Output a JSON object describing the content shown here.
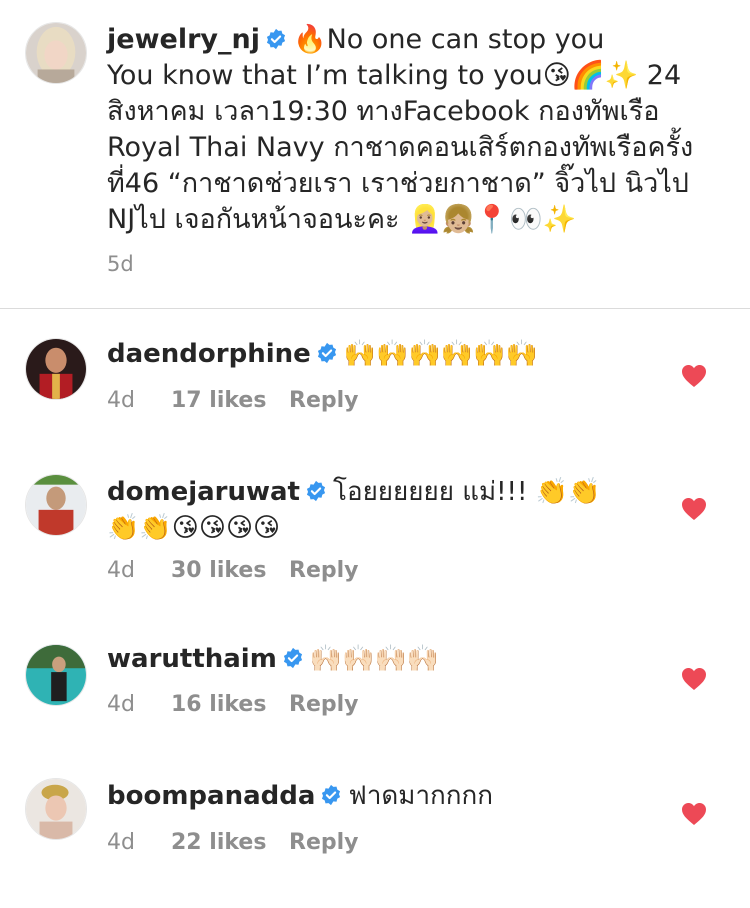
{
  "caption": {
    "username": "jewelry_nj",
    "line1": "🔥No one can stop you",
    "line2": "You know that I’m talking to you😘🌈✨ 24",
    "line3": "สิงหาคม เวลา19:30 ทางFacebook กองทัพเรือ",
    "line4": "Royal Thai Navy กาชาดคอนเสิร์ตกองทัพเรือครั้ง",
    "line5": "ที่46 “กาชาดช่วยเรา เราช่วยกาชาด” จิ๊วไป นิวไป",
    "line6": "NJไป เจอกันหน้าจอนะคะ 👱🏼‍♀️👧🏼📍👀✨",
    "time": "5d"
  },
  "comments": [
    {
      "username": "daendorphine",
      "line1": "🙌🙌🙌🙌🙌🙌",
      "line2": "",
      "time": "4d",
      "likes": "17 likes",
      "reply": "Reply"
    },
    {
      "username": "domejaruwat",
      "line1": "โอยยยยยย แม่!!! 👏👏",
      "line2": "👏👏😘😘😘😘",
      "time": "4d",
      "likes": "30 likes",
      "reply": "Reply"
    },
    {
      "username": "warutthaim",
      "line1": "🙌🏻🙌🏻🙌🏻🙌🏻",
      "line2": "",
      "time": "4d",
      "likes": "16 likes",
      "reply": "Reply"
    },
    {
      "username": "boompanadda",
      "line1": "ฟาดมากกกก",
      "line2": "",
      "time": "4d",
      "likes": "22 likes",
      "reply": "Reply"
    }
  ],
  "colors": {
    "verified_blue": "#3897f0",
    "heart_red": "#ed4956",
    "muted_gray": "#8e8e8e",
    "text": "#262626"
  },
  "icons": {
    "verified": "verified-badge-icon",
    "like": "heart-icon"
  }
}
